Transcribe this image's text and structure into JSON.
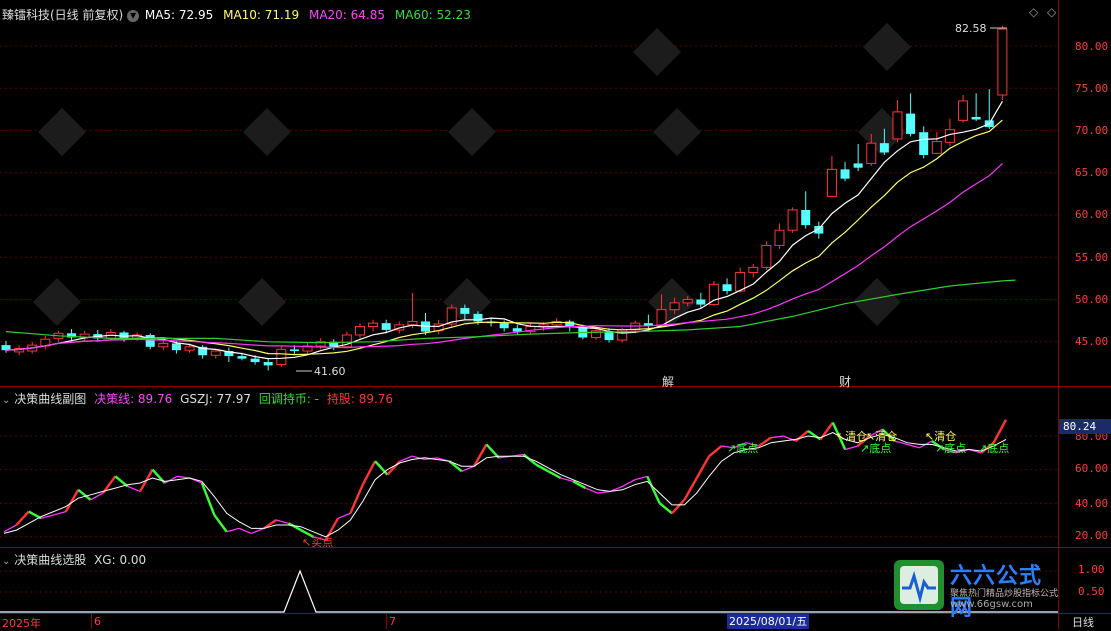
{
  "main_panel": {
    "title": "臻镭科技(日线 前复权)",
    "ma5": "MA5: 72.95",
    "ma10": "MA10: 71.19",
    "ma20": "MA20: 64.85",
    "ma60": "MA60: 52.23",
    "high_marker": "82.58",
    "low_marker": "41.60",
    "event_1": "解",
    "event_2": "财",
    "y_ticks": [
      "80.00",
      "75.00",
      "70.00",
      "65.00",
      "60.00",
      "55.00",
      "50.00",
      "45.00"
    ]
  },
  "sub_panel": {
    "title": "决策曲线副图",
    "decision_line": "决策线: 89.76",
    "gszj": "GSZJ: 77.97",
    "pullback": "回调持币: -",
    "hold": "持股: 89.76",
    "current_value": "80.24",
    "buy_label": "买点",
    "clear_labels": [
      "清仓",
      "清仓",
      "清仓"
    ],
    "bottom_labels": [
      "底点",
      "底点",
      "底点",
      "底点"
    ],
    "y_ticks": [
      "80.00",
      "60.00",
      "40.00",
      "20.00"
    ]
  },
  "select_panel": {
    "title": "决策曲线选股",
    "xg": "XG: 0.00",
    "y_ticks": [
      "1.00",
      "0.50"
    ]
  },
  "time_axis": {
    "labels": [
      "2025年",
      "6",
      "7"
    ],
    "highlight": "2025/08/01/五",
    "period": "日线"
  },
  "watermark": {
    "brand": "六六公式网",
    "slogan": "聚焦热门精品炒股指标公式",
    "url": "www.66gsw.com"
  },
  "colors": {
    "up": "#ff3333",
    "down": "#54ffff",
    "ma5": "#ffffff",
    "ma10": "#ffff66",
    "ma20": "#ff33ff",
    "ma60": "#33cc33"
  }
}
